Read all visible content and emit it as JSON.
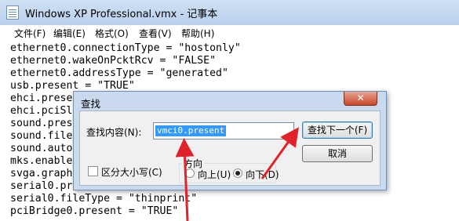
{
  "window": {
    "title": "Windows XP Professional.vmx - 记事本"
  },
  "menu": [
    "文件(F)",
    "编辑(E)",
    "格式(O)",
    "查看(V)",
    "帮助(H)"
  ],
  "editor": {
    "lines": [
      "ethernet0.connectionType = \"hostonly\"",
      "ethernet0.wakeOnPcktRcv = \"FALSE\"",
      "ethernet0.addressType = \"generated\"",
      "usb.present = \"TRUE\"",
      "ehci.prese",
      "ehci.pciSl",
      "sound.pres",
      "sound.file",
      "sound.auto",
      "mks.enable",
      "svga.graph",
      "serial0.pr",
      "serial0.fileType = \"thinprint\"",
      "pciBridge0.present = \"TRUE\""
    ]
  },
  "find_dialog": {
    "title": "查找",
    "close_label": "✕",
    "find_label": "查找内容(N):",
    "find_value": "vmci0.present",
    "find_next_label": "查找下一个(F)",
    "cancel_label": "取消",
    "match_case_label": "区分大小写(C)",
    "direction_label": "方向",
    "up_label": "向上(U)",
    "down_label": "向下(D)",
    "direction_selected": "down"
  },
  "colors": {
    "annotation_arrow": "#e0232b",
    "selection": "#3399ff"
  }
}
